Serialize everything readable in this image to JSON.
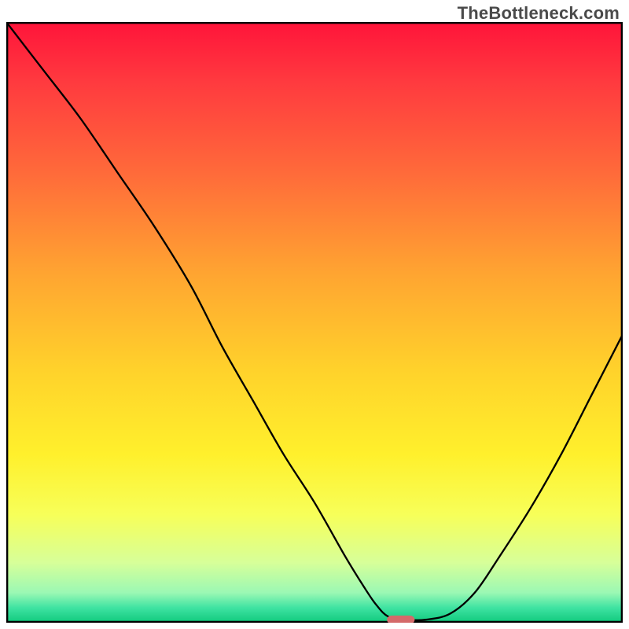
{
  "watermark": "TheBottleneck.com",
  "chart_data": {
    "type": "line",
    "title": "",
    "xlabel": "",
    "ylabel": "",
    "xlim": [
      0,
      100
    ],
    "ylim": [
      0,
      100
    ],
    "grid": false,
    "legend": false,
    "series": [
      {
        "name": "curve",
        "x": [
          0,
          6,
          12,
          18,
          24,
          30,
          35,
          40,
          45,
          50,
          55,
          58,
          60,
          62,
          65,
          68,
          72,
          76,
          80,
          85,
          90,
          95,
          100
        ],
        "y": [
          100,
          92,
          84,
          75,
          66,
          56,
          46,
          37,
          28,
          20,
          11,
          6,
          3,
          1,
          0.5,
          0.5,
          1.5,
          5,
          11,
          19,
          28,
          38,
          48
        ]
      }
    ],
    "marker": {
      "description": "rounded highlight near curve minimum",
      "x": 64,
      "y": 0.5,
      "width_pct": 4.5,
      "height_pct": 1.4,
      "color": "#d46a6a"
    },
    "background_gradient_stops": [
      {
        "pos": 0.0,
        "color": "#ff143a"
      },
      {
        "pos": 0.1,
        "color": "#ff3a3f"
      },
      {
        "pos": 0.25,
        "color": "#ff6a3a"
      },
      {
        "pos": 0.42,
        "color": "#ffa531"
      },
      {
        "pos": 0.58,
        "color": "#ffd22b"
      },
      {
        "pos": 0.72,
        "color": "#fff02c"
      },
      {
        "pos": 0.82,
        "color": "#f7ff59"
      },
      {
        "pos": 0.9,
        "color": "#d7ff99"
      },
      {
        "pos": 0.95,
        "color": "#9bf8b4"
      },
      {
        "pos": 0.975,
        "color": "#3fe3a2"
      },
      {
        "pos": 1.0,
        "color": "#0fc97c"
      }
    ],
    "frame_color": "#000000",
    "curve_color": "#000000",
    "curve_stroke_width": 3
  }
}
